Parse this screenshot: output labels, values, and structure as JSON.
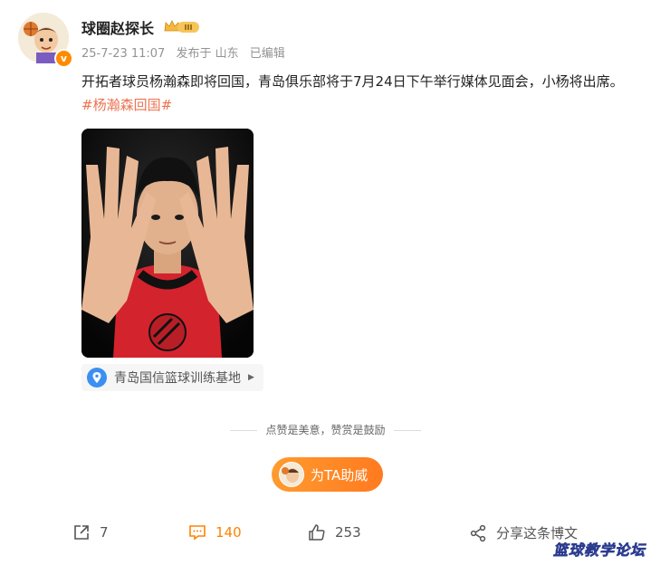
{
  "user": {
    "name": "球圈赵探长",
    "level_badge": "III",
    "verified_mark": "v"
  },
  "meta": {
    "time": "25-7-23 11:07",
    "location": "发布于 山东",
    "edited": "已编辑"
  },
  "post": {
    "text": "开拓者球员杨瀚森即将回国，青岛俱乐部将于7月24日下午举行媒体见面会，小杨将出席。",
    "hashtag": "#杨瀚森回国#"
  },
  "place": {
    "label": "青岛国信篮球训练基地",
    "icon": "location-pin-icon"
  },
  "reward": {
    "caption": "点赞是美意，赞赏是鼓励",
    "button_label": "为TA助威"
  },
  "actions": {
    "share_count": "7",
    "comment_count": "140",
    "like_count": "253",
    "share_post_label": "分享这条博文"
  },
  "watermark": "篮球教学论坛",
  "colors": {
    "accent_orange": "#ff8200",
    "hashtag": "#eb7350",
    "meta_gray": "#939393"
  }
}
